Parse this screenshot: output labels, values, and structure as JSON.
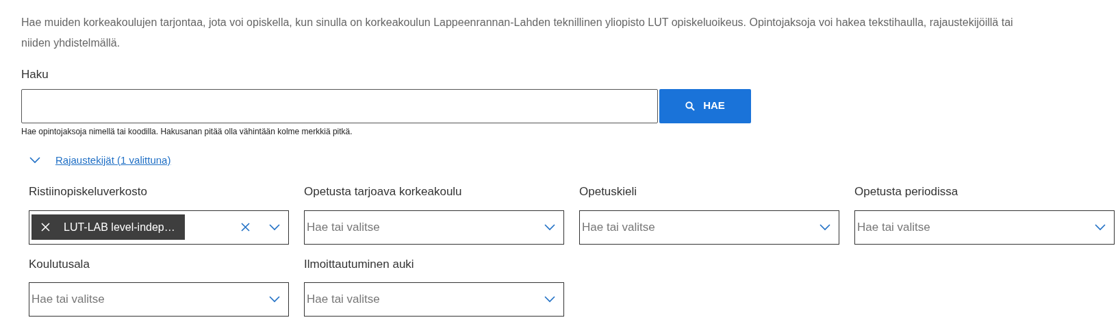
{
  "intro": "Hae muiden korkeakoulujen tarjontaa, jota voi opiskella, kun sinulla on korkeakoulun Lappeenrannan-Lahden teknillinen yliopisto LUT opiskeluoikeus. Opintojaksoja voi hakea tekstihaulla, rajaustekijöillä tai niiden yhdistelmällä.",
  "search": {
    "label": "Haku",
    "button": "HAE",
    "hint": "Hae opintojaksoja nimellä tai koodilla. Hakusanan pitää olla vähintään kolme merkkiä pitkä."
  },
  "filters_toggle": {
    "label": "Rajaustekijät (1 valittuna)",
    "expanded": true
  },
  "filters": [
    {
      "label": "Ristiinopiskeluverkosto",
      "chips": [
        "LUT-LAB level-indep…"
      ]
    },
    {
      "label": "Opetusta tarjoava korkeakoulu",
      "placeholder": "Hae tai valitse"
    },
    {
      "label": "Opetuskieli",
      "placeholder": "Hae tai valitse"
    },
    {
      "label": "Opetusta periodissa",
      "placeholder": "Hae tai valitse"
    },
    {
      "label": "Koulutusala",
      "placeholder": "Hae tai valitse"
    },
    {
      "label": "Ilmoittautuminen auki",
      "placeholder": "Hae tai valitse"
    }
  ]
}
